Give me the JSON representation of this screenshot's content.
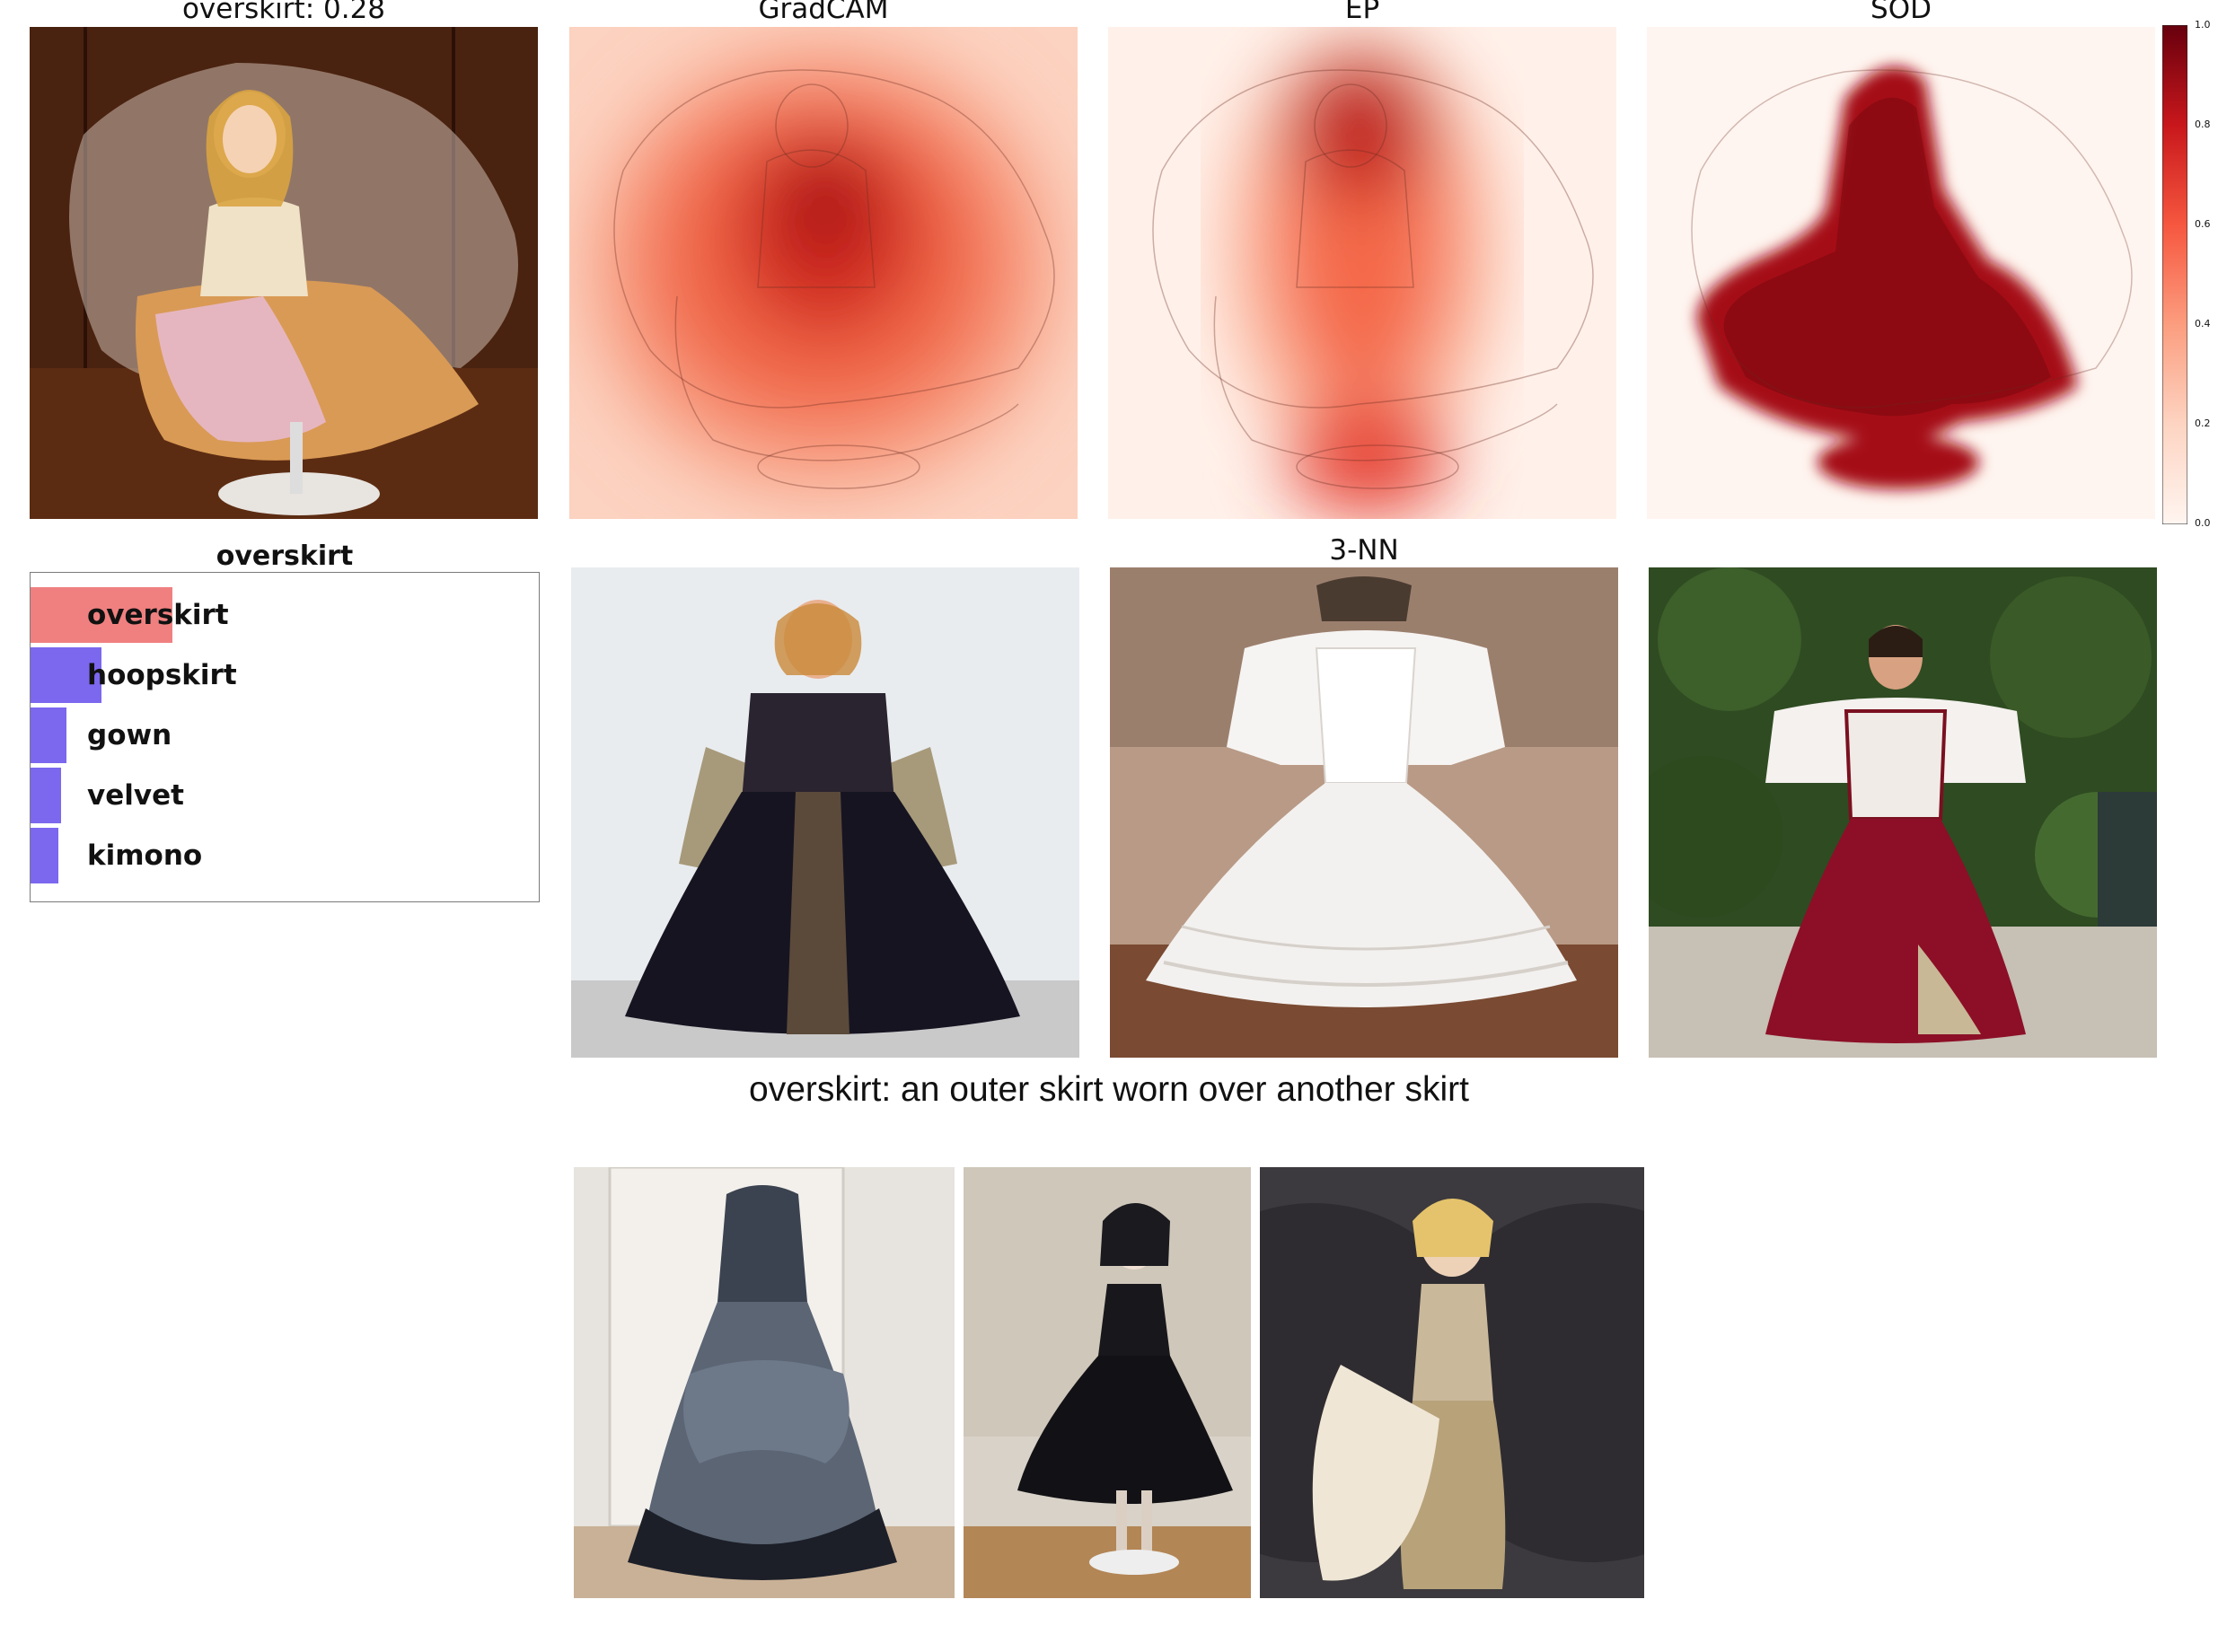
{
  "row1": {
    "input_title": "overskirt: 0.28",
    "gradcam_title": "GradCAM",
    "ep_title": "EP",
    "sod_title": "SOD"
  },
  "colorbar": {
    "colormap": "Reds",
    "ticks": [
      "1.0",
      "0.8",
      "0.6",
      "0.4",
      "0.2",
      "0.0"
    ]
  },
  "nn_title": "3-NN",
  "caption": "overskirt: an outer skirt worn over another skirt",
  "chart_data": {
    "type": "bar",
    "orientation": "horizontal",
    "title": "overskirt",
    "categories": [
      "overskirt",
      "hoopskirt",
      "gown",
      "velvet",
      "kimono"
    ],
    "values": [
      0.28,
      0.14,
      0.07,
      0.06,
      0.055
    ],
    "colors": [
      "#f08080",
      "#7b68ee",
      "#7b68ee",
      "#7b68ee",
      "#7b68ee"
    ],
    "xlim": [
      0,
      1
    ],
    "grid": false
  },
  "images": {
    "input": "doll-in-wedding-dress-photo",
    "gradcam": "gradcam-heatmap",
    "ep": "ep-heatmap",
    "sod": "sod-heatmap",
    "nn1": "renaissance-gown-photo",
    "nn2": "white-ruffled-dress-photo",
    "nn3": "red-velvet-gown-photo",
    "proto1": "grey-bustle-dress-photo",
    "proto2": "black-dress-doll-photo",
    "proto3": "champagne-gown-photo"
  }
}
